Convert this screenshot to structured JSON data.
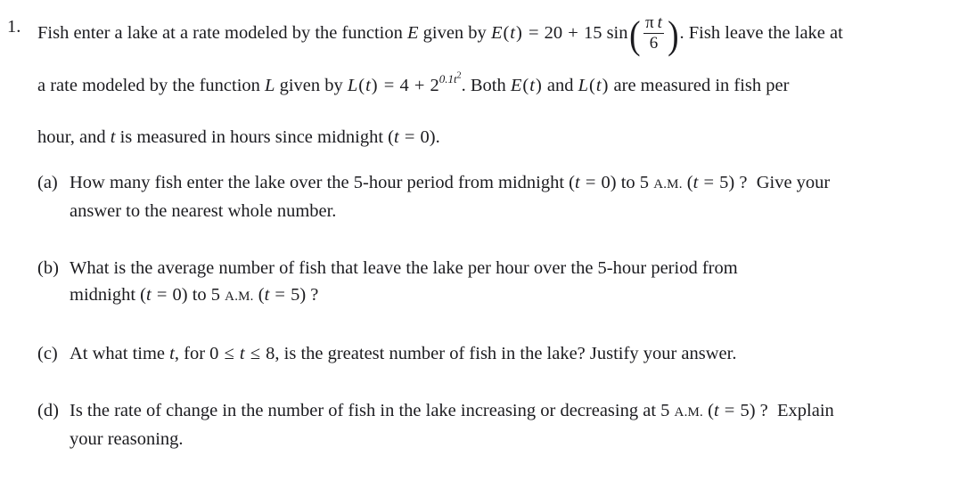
{
  "problem": {
    "number": "1.",
    "stem_lines": [
      {
        "segments": [
          {
            "type": "text",
            "value": "Fish enter a lake at a rate modeled by the function "
          },
          {
            "type": "italic",
            "value": "E"
          },
          {
            "type": "text",
            "value": " given by "
          },
          {
            "type": "italic",
            "value": "E"
          },
          {
            "type": "text",
            "value": "("
          },
          {
            "type": "italic",
            "value": "t"
          },
          {
            "type": "text",
            "value": ") = 20 + 15 sin"
          },
          {
            "type": "fraction",
            "numerator": "π t",
            "denominator": "6"
          },
          {
            "type": "text",
            "value": ". Fish leave the lake at"
          }
        ],
        "plain": "Fish enter a lake at a rate modeled by the function E given by E(t) = 20 + 15 sin(π t / 6). Fish leave the lake at"
      },
      {
        "plain": "a rate modeled by the function L given by L(t) = 4 + 2^(0.1t²). Both E(t) and L(t) are measured in fish per"
      },
      {
        "plain": "hour, and t is measured in hours since midnight (t = 0)."
      }
    ],
    "formula_E": "E(t) = 20 + 15 sin(πt/6)",
    "formula_L": "L(t) = 4 + 2^(0.1t²)",
    "exponent_base": "2",
    "exponent_coefficient": "0.1",
    "exponent_variable": "t",
    "exponent_power": "2"
  },
  "parts": [
    {
      "label": "(a)",
      "lines": [
        "How many fish enter the lake over the 5-hour period from midnight (t = 0) to 5 A.M. (t = 5) ?  Give your",
        "answer to the nearest whole number."
      ]
    },
    {
      "label": "(b)",
      "lines": [
        "What is the average number of fish that leave the lake per hour over the 5-hour period from",
        "midnight (t = 0) to 5 A.M. (t = 5) ?"
      ]
    },
    {
      "label": "(c)",
      "lines": [
        "At what time t, for 0 ≤ t ≤ 8, is the greatest number of fish in the lake? Justify your answer."
      ]
    },
    {
      "label": "(d)",
      "lines": [
        "Is the rate of change in the number of fish in the lake increasing or decreasing at 5 A.M. (t = 5) ?  Explain",
        "your reasoning."
      ]
    }
  ],
  "colors": {
    "text": "#1b1b1f",
    "background": "#ffffff"
  }
}
